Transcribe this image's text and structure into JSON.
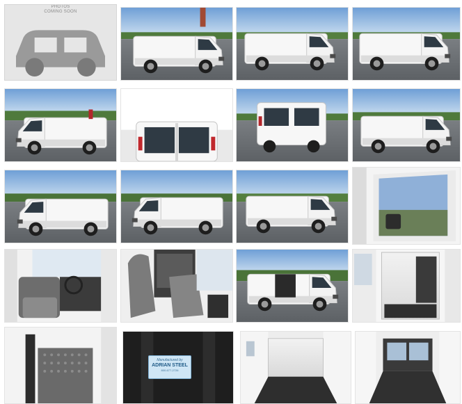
{
  "gallery": {
    "placeholder": {
      "line1": "PHOTOS",
      "line2": "COMING SOON",
      "icon": "car-icon"
    },
    "photos": [
      {
        "id": "p2",
        "subject": "exterior-front-left"
      },
      {
        "id": "p3",
        "subject": "exterior-left-side"
      },
      {
        "id": "p4",
        "subject": "exterior-left-side-2"
      },
      {
        "id": "p5",
        "subject": "exterior-rear-left"
      },
      {
        "id": "p6",
        "subject": "exterior-rear-doors"
      },
      {
        "id": "p7",
        "subject": "exterior-rear-right"
      },
      {
        "id": "p8",
        "subject": "exterior-right-side"
      },
      {
        "id": "p9",
        "subject": "exterior-front-right"
      },
      {
        "id": "p10",
        "subject": "exterior-front-right-2"
      },
      {
        "id": "p11",
        "subject": "exterior-left-side-3"
      },
      {
        "id": "p12",
        "subject": "driver-door-mirror"
      },
      {
        "id": "p13",
        "subject": "cab-interior-driver"
      },
      {
        "id": "p14",
        "subject": "cab-seats-partition"
      },
      {
        "id": "p15",
        "subject": "side-door-open"
      },
      {
        "id": "p16",
        "subject": "cargo-area-side-view"
      },
      {
        "id": "p17",
        "subject": "partition-mesh"
      },
      {
        "id": "p18",
        "subject": "upfitter-label"
      },
      {
        "id": "p19",
        "subject": "cargo-floor-front"
      },
      {
        "id": "p20",
        "subject": "cargo-floor-rear-doors"
      }
    ],
    "label": {
      "top": "Manufactured by",
      "brand": "ADRIAN STEEL",
      "small": "800-677-2726"
    }
  }
}
